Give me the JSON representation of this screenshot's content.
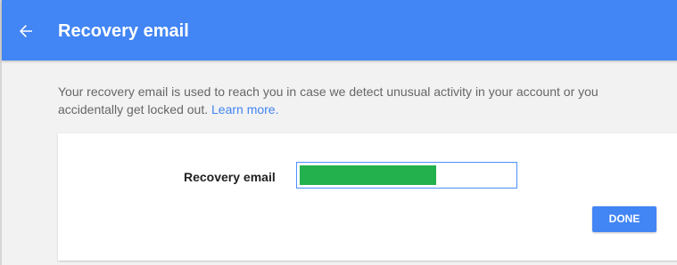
{
  "header": {
    "title": "Recovery email",
    "back_icon": "arrow-left-icon"
  },
  "description": {
    "text": "Your recovery email is used to reach you in case we detect unusual activity in your account or you accidentally get locked out.",
    "link_text": "Learn more."
  },
  "form": {
    "label": "Recovery email",
    "input_value": "",
    "done_label": "DONE"
  },
  "colors": {
    "accent": "#4285f4",
    "background": "#f2f2f2",
    "redaction": "#22b14c"
  }
}
